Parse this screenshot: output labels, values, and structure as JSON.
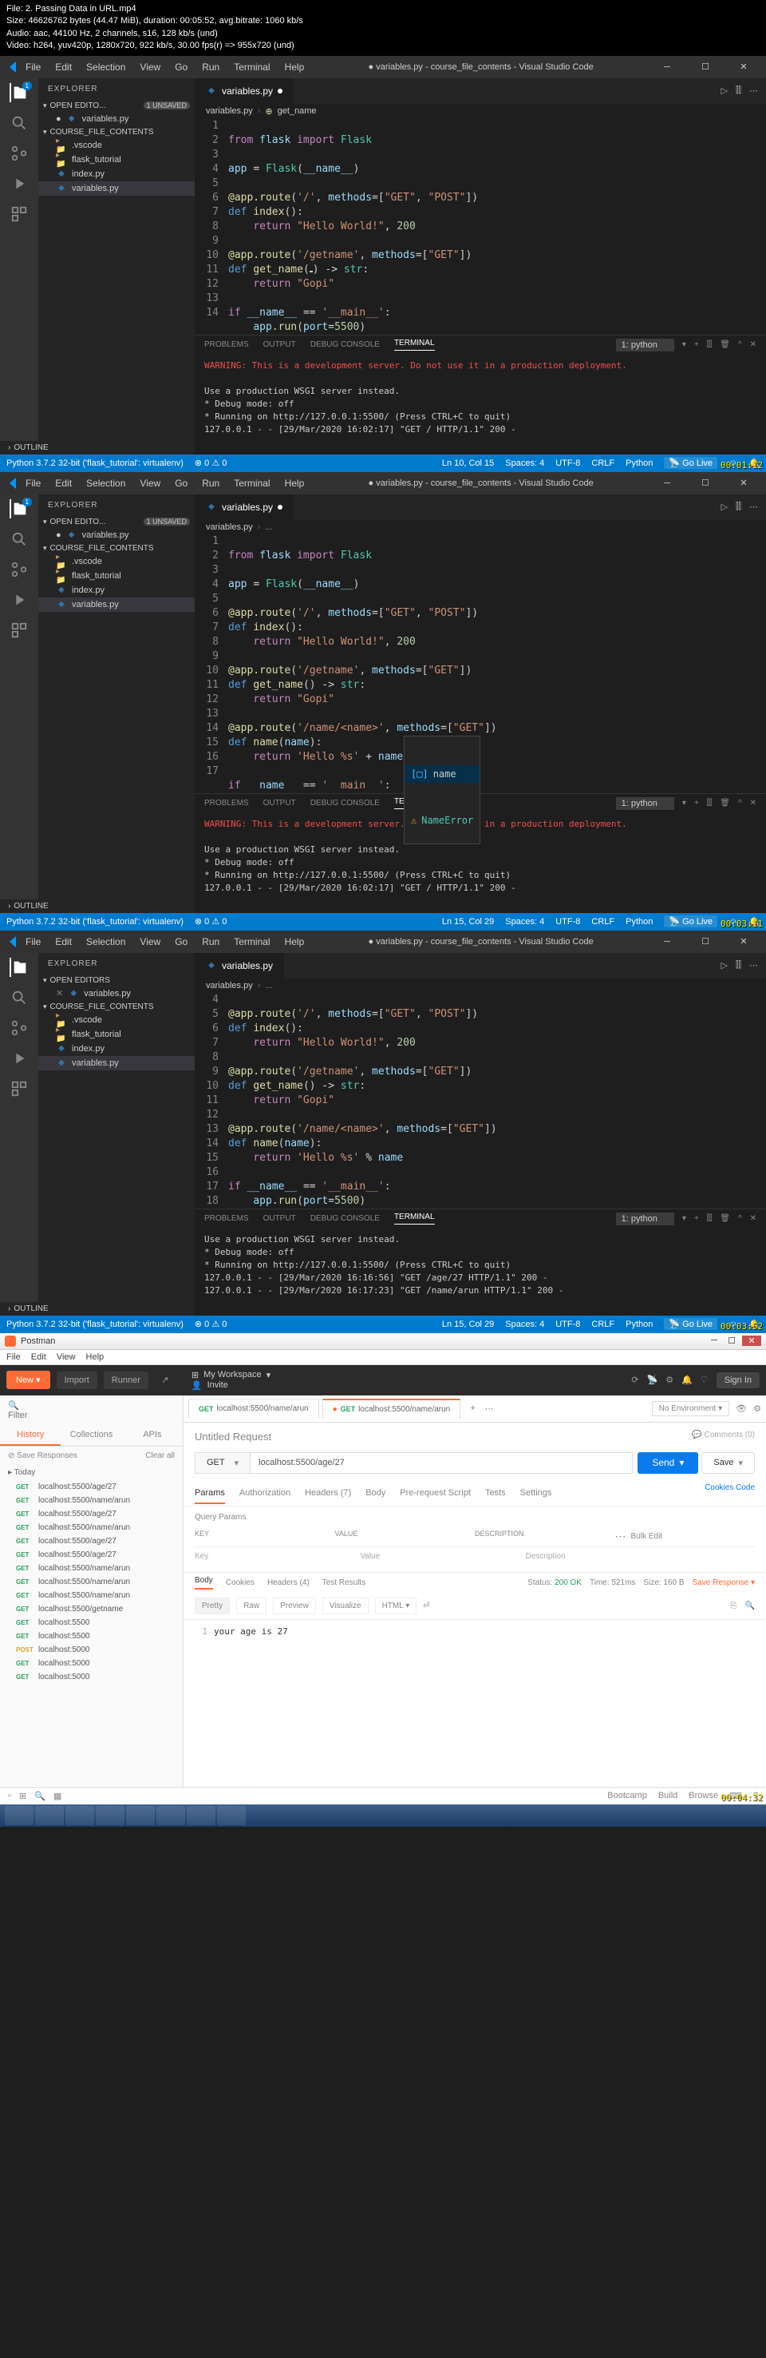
{
  "file_meta": {
    "line1": "File: 2. Passing Data in URL.mp4",
    "line2": "Size: 46626762 bytes (44.47 MiB), duration: 00:05:52, avg.bitrate: 1060 kb/s",
    "line3": "Audio: aac, 44100 Hz, 2 channels, s16, 128 kb/s (und)",
    "line4": "Video: h264, yuv420p, 1280x720, 922 kb/s, 30.00 fps(r) => 955x720 (und)"
  },
  "vscode": {
    "menus": [
      "File",
      "Edit",
      "Selection",
      "View",
      "Go",
      "Run",
      "Terminal",
      "Help"
    ],
    "title": "● variables.py - course_file_contents - Visual Studio Code",
    "explorer_label": "EXPLORER",
    "open_editors": "OPEN EDITO...",
    "unsaved_badge": "1 UNSAVED",
    "open_editors2": "OPEN EDITORS",
    "workspace": "COURSE_FILE_CONTENTS",
    "files": {
      "vscode": ".vscode",
      "flask": "flask_tutorial",
      "index": "index.py",
      "variables": "variables.py"
    },
    "tab_name": "variables.py",
    "breadcrumb1": "variables.py",
    "breadcrumb2": "get_name",
    "outline": "OUTLINE",
    "statusbar": {
      "python": "Python 3.7.2 32-bit ('flask_tutorial': virtualenv)",
      "errors": "⊗ 0 ⚠ 0",
      "position1": "Ln 10, Col 15",
      "position2": "Ln 15, Col 29",
      "spaces": "Spaces: 4",
      "encoding": "UTF-8",
      "eol": "CRLF",
      "lang": "Python",
      "golive": "Go Live"
    },
    "terminal": {
      "tabs": [
        "PROBLEMS",
        "OUTPUT",
        "DEBUG CONSOLE",
        "TERMINAL"
      ],
      "shell": "1: python",
      "warn": "WARNING: This is a development server. Do not use it in a production deployment.",
      "wsgi": "Use a production WSGI server instead.",
      "debug": "* Debug mode: off",
      "running": "* Running on http://127.0.0.1:5500/ (Press CTRL+C to quit)",
      "log1": "127.0.0.1 - - [29/Mar/2020 16:02:17] \"GET / HTTP/1.1\" 200 -",
      "log2": "127.0.0.1 - - [29/Mar/2020 16:16:56] \"GET /age/27 HTTP/1.1\" 200 -",
      "log3": "127.0.0.1 - - [29/Mar/2020 16:17:23] \"GET /name/arun HTTP/1.1\" 200 -"
    },
    "code1": {
      "1": "from flask import Flask",
      "3": "app = Flask(__name__)",
      "5": "@app.route('/', methods=[\"GET\", \"POST\"])",
      "6": "def index():",
      "7": "    return \"Hello World!\", 200",
      "9": "@app.route('/getname', methods=[\"GET\"])",
      "10": "def get_name() -> str:",
      "11": "    return \"Gopi\"",
      "13": "if __name__ == '__main__':",
      "14": "    app.run(port=5500)"
    },
    "code2_extra": {
      "13": "@app.route('/name/<name>', methods=[\"GET\"])",
      "14": "def name(name):",
      "15": "    return 'Hello %s' + name",
      "17": "if   name   == '  main  ':"
    },
    "suggest": {
      "item1": "name",
      "item2": "NameError"
    },
    "code3_extra": {
      "15": "    return 'Hello %s' % name",
      "17": "if __name__ == '__main__':",
      "18": "    app.run(port=5500)"
    },
    "timestamps": [
      "00:01:12",
      "00:03:11",
      "00:03:52",
      "00:04:32"
    ]
  },
  "postman": {
    "title": "Postman",
    "menu": [
      "File",
      "Edit",
      "View",
      "Help"
    ],
    "toolbar": {
      "new": "New",
      "import": "Import",
      "runner": "Runner",
      "workspace": "My Workspace",
      "invite": "Invite",
      "signin": "Sign In"
    },
    "filter_ph": "Filter",
    "side_tabs": [
      "History",
      "Collections",
      "APIs"
    ],
    "save_responses": "Save Responses",
    "clear_all": "Clear all",
    "today": "Today",
    "history": [
      {
        "m": "GET",
        "u": "localhost:5500/age/27"
      },
      {
        "m": "GET",
        "u": "localhost:5500/name/arun"
      },
      {
        "m": "GET",
        "u": "localhost:5500/age/27"
      },
      {
        "m": "GET",
        "u": "localhost:5500/name/arun"
      },
      {
        "m": "GET",
        "u": "localhost:5500/age/27"
      },
      {
        "m": "GET",
        "u": "localhost:5500/age/27"
      },
      {
        "m": "GET",
        "u": "localhost:5500/name/arun"
      },
      {
        "m": "GET",
        "u": "localhost:5500/name/arun"
      },
      {
        "m": "GET",
        "u": "localhost:5500/name/arun"
      },
      {
        "m": "GET",
        "u": "localhost:5500/getname"
      },
      {
        "m": "GET",
        "u": "localhost:5500"
      },
      {
        "m": "GET",
        "u": "localhost:5500"
      },
      {
        "m": "POST",
        "u": "localhost:5000"
      },
      {
        "m": "GET",
        "u": "localhost:5000"
      },
      {
        "m": "GET",
        "u": "localhost:5000"
      }
    ],
    "req_tabs": [
      {
        "m": "GET",
        "label": "localhost:5500/name/arun"
      },
      {
        "m": "GET",
        "label": "localhost:5500/name/arun"
      }
    ],
    "request_name": "Untitled Request",
    "comments": "Comments (0)",
    "no_env": "No Environment",
    "method": "GET",
    "url": "localhost:5500/age/27",
    "send": "Send",
    "save": "Save",
    "req_section_tabs": [
      "Params",
      "Authorization",
      "Headers (7)",
      "Body",
      "Pre-request Script",
      "Tests",
      "Settings"
    ],
    "cookies": "Cookies  Code",
    "query_params": "Query Params",
    "params_head": [
      "KEY",
      "VALUE",
      "DESCRIPTION"
    ],
    "params_row": [
      "Key",
      "Value",
      "Description"
    ],
    "bulk_edit": "Bulk Edit",
    "resp_tabs": [
      "Body",
      "Cookies",
      "Headers (4)",
      "Test Results"
    ],
    "status": {
      "code": "200 OK",
      "time": "Time: 521ms",
      "size": "Size: 160 B",
      "save": "Save Response"
    },
    "view_tabs": [
      "Pretty",
      "Raw",
      "Preview",
      "Visualize"
    ],
    "html_dd": "HTML",
    "response_body": "your age is 27",
    "bottom": {
      "console": "",
      "build": "Build",
      "browse": "Browse",
      "bootcamp": "Bootcamp"
    }
  }
}
